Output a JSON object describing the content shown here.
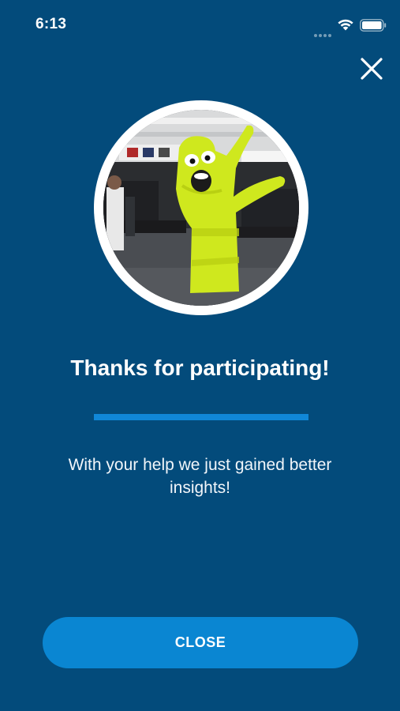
{
  "status_bar": {
    "time": "6:13"
  },
  "icons": {
    "wifi": "wifi-icon",
    "battery": "battery-icon",
    "close": "close-icon"
  },
  "content": {
    "title": "Thanks for participating!",
    "message": "With your help we just gained better insights!"
  },
  "actions": {
    "close_label": "CLOSE"
  },
  "colors": {
    "background": "#034b7b",
    "accent": "#1087d8",
    "button": "#0a86d2",
    "text": "#ffffff"
  }
}
